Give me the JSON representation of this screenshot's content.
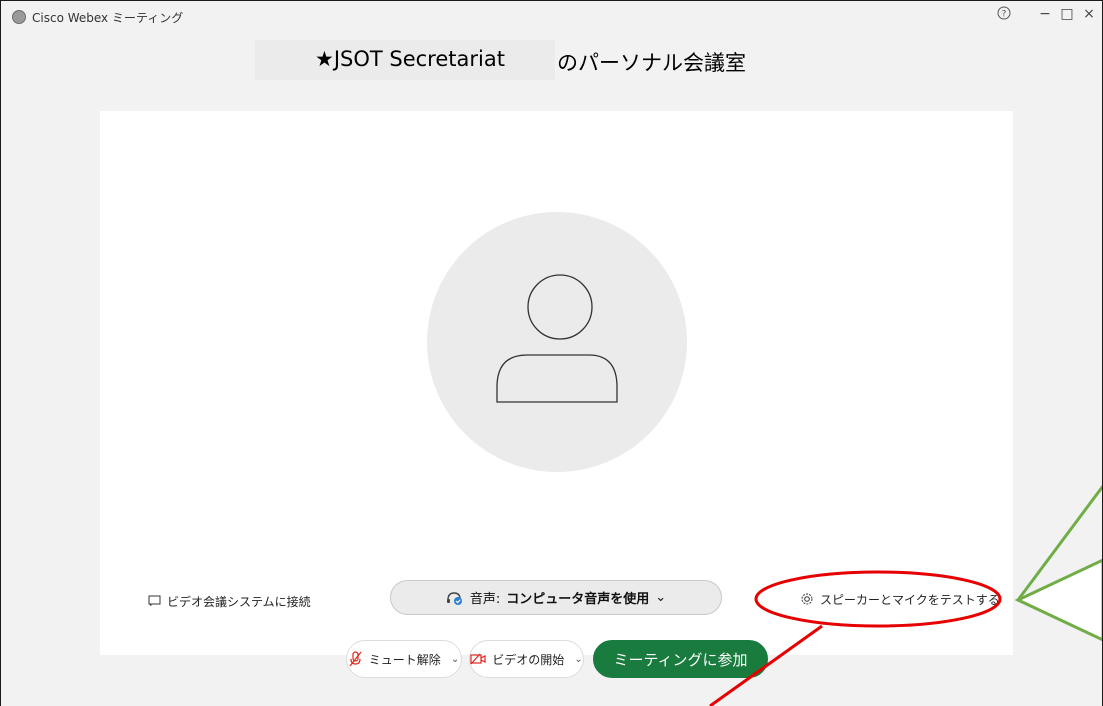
{
  "titlebar": {
    "app_title": "Cisco Webex ミーティング",
    "help_icon": "?",
    "minimize": "−",
    "maximize": "□",
    "close": "×"
  },
  "meeting": {
    "host_name": "★JSOT Secretariat",
    "room_suffix": "のパーソナル会議室"
  },
  "preview": {
    "connect_label": "ビデオ会議システムに接続",
    "audio_prefix": "音声:",
    "audio_value": "コンピュータ音声を使用",
    "audio_chevron": "⌄",
    "test_label": "スピーカーとマイクをテストする"
  },
  "controls": {
    "mute_label": "ミュート解除",
    "video_label": "ビデオの開始",
    "join_label": "ミーティングに参加",
    "chevron": "⌄"
  },
  "colors": {
    "join_button": "#1a7b3f",
    "annotation_red": "#e60000",
    "annotation_green": "#70ad47"
  }
}
